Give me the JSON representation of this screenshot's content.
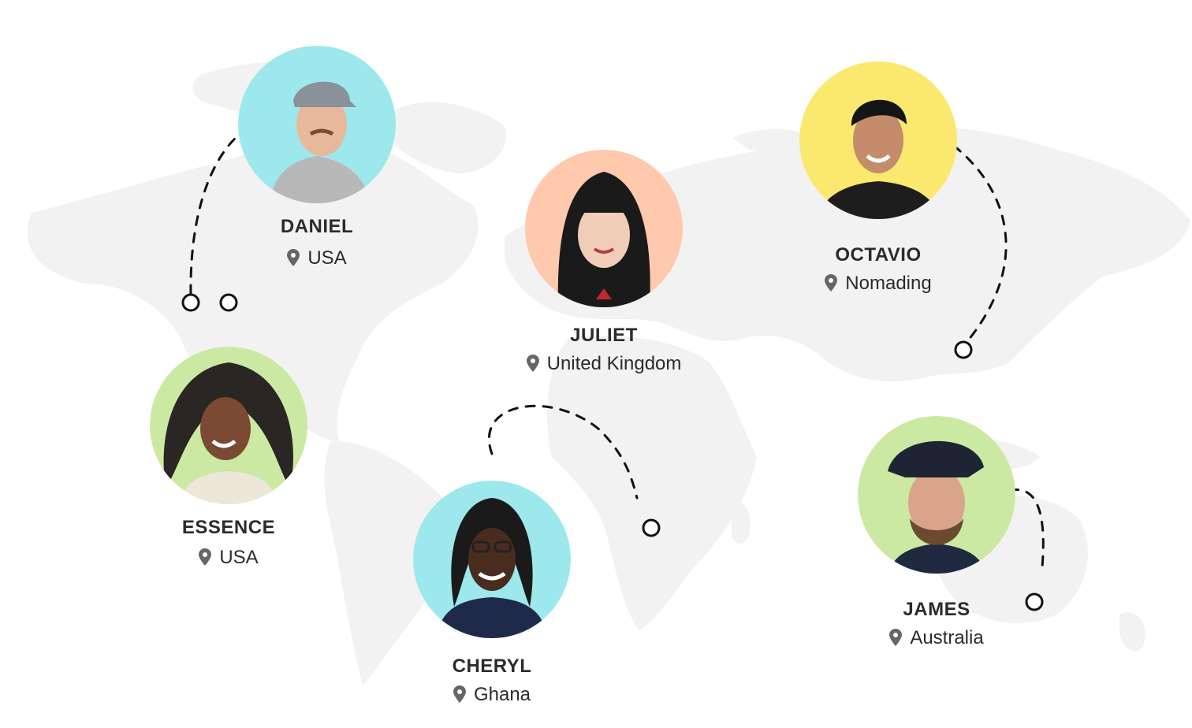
{
  "people": [
    {
      "name": "DANIEL",
      "location": "USA",
      "color": "#9de8ec",
      "pin_icon": "location-pin-icon"
    },
    {
      "name": "JULIET",
      "location": "United Kingdom",
      "color": "#ffc9ad",
      "pin_icon": "location-pin-icon"
    },
    {
      "name": "OCTAVIO",
      "location": "Nomading",
      "color": "#fae96e",
      "pin_icon": "location-pin-icon"
    },
    {
      "name": "ESSENCE",
      "location": "USA",
      "color": "#cbe9a3",
      "pin_icon": "location-pin-icon"
    },
    {
      "name": "CHERYL",
      "location": "Ghana",
      "color": "#9de8ec",
      "pin_icon": "location-pin-icon"
    },
    {
      "name": "JAMES",
      "location": "Australia",
      "color": "#cbe9a3",
      "pin_icon": "location-pin-icon"
    }
  ],
  "colors": {
    "map": "#efefef",
    "text": "#2b2b2b",
    "route": "#111111",
    "pin": "#666666"
  }
}
